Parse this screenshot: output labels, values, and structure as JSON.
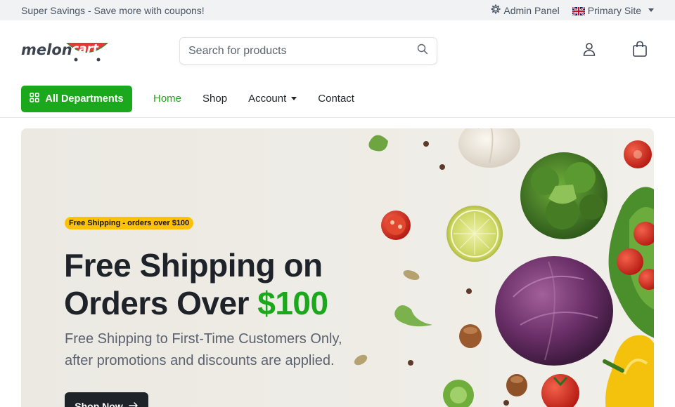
{
  "topbar": {
    "promo": "Super Savings - Save more with coupons!",
    "admin_label": "Admin Panel",
    "site_label": "Primary Site"
  },
  "header": {
    "logo_word": "melon",
    "logo_cart": "cart",
    "search_placeholder": "Search for products"
  },
  "nav": {
    "departments_label": "All Departments",
    "links": [
      {
        "label": "Home",
        "active": true
      },
      {
        "label": "Shop"
      },
      {
        "label": "Account",
        "dropdown": true
      },
      {
        "label": "Contact"
      }
    ]
  },
  "hero": {
    "badge": "Free Shipping - orders over $100",
    "title_line1": "Free Shipping on",
    "title_line2_prefix": "Orders Over ",
    "title_line2_accent": "$100",
    "subtitle": "Free Shipping to First-Time Customers Only, after promotions and discounts are applied.",
    "button_label": "Shop Now"
  },
  "colors": {
    "accent": "#1ca81c",
    "badge": "#ffc107",
    "dark": "#1e2229",
    "hero_bg": "#eae7e1"
  }
}
